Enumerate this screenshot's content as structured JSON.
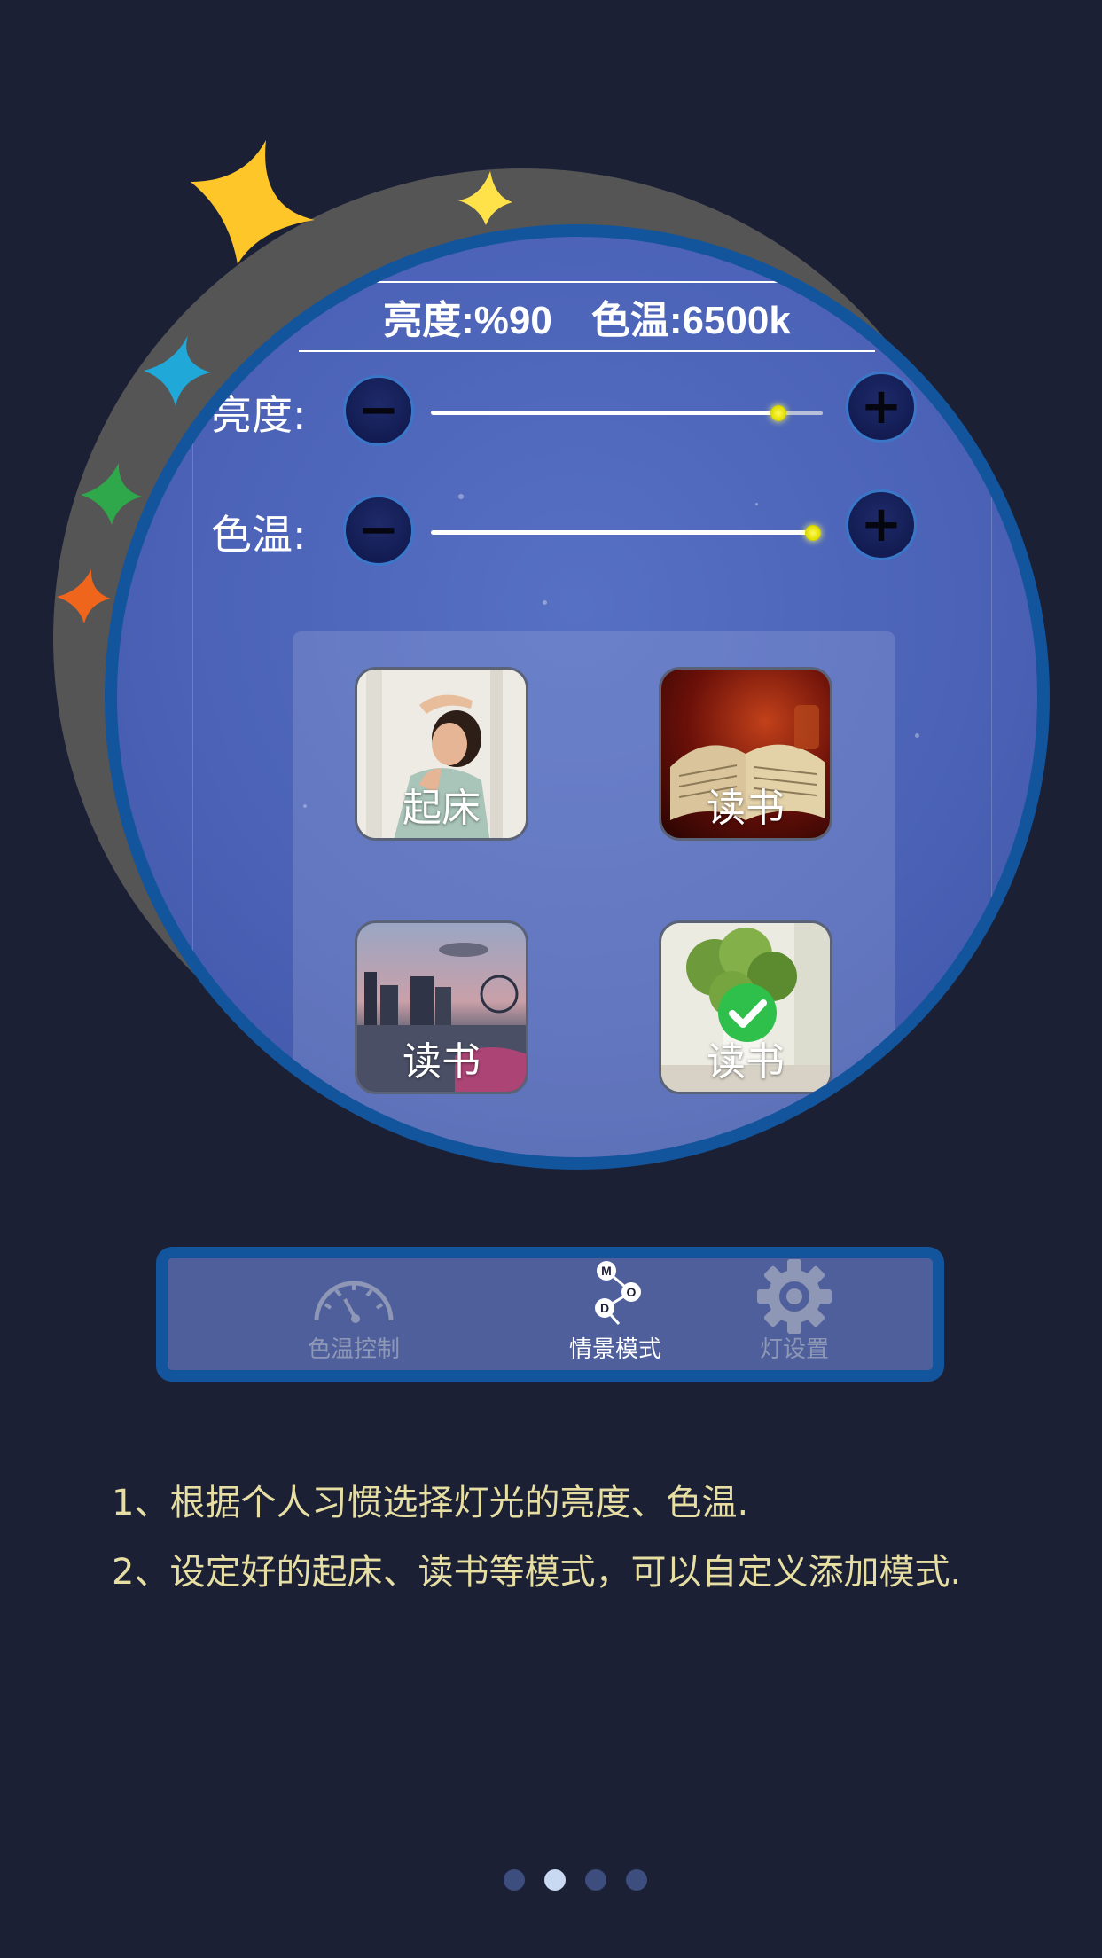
{
  "status": {
    "brightness_text": "亮度:%90",
    "color_temp_text": "色温:6500k"
  },
  "controls": {
    "brightness_label": "亮度:",
    "color_temp_label": "色温:",
    "minus_symbol": "−",
    "plus_symbol": "+",
    "brightness_value": 0.88,
    "color_temp_value": 0.97
  },
  "scenes": [
    {
      "label": "起床",
      "image": "woman-waking-up",
      "selected": false
    },
    {
      "label": "读书",
      "image": "open-book",
      "selected": false
    },
    {
      "label": "读书",
      "image": "city-at-dusk",
      "selected": false
    },
    {
      "label": "读书",
      "image": "potted-plant",
      "selected": true
    }
  ],
  "nav": [
    {
      "label": "色温控制",
      "icon": "gauge-icon",
      "active": false
    },
    {
      "label": "情景模式",
      "icon": "mode-nodes-icon",
      "active": true,
      "icon_letters": [
        "M",
        "O",
        "D"
      ]
    },
    {
      "label": "灯设置",
      "icon": "gear-icon",
      "active": false
    }
  ],
  "description": [
    "1、根据个人习惯选择灯光的亮度、色温.",
    "2、设定好的起床、读书等模式，可以自定义添加模式."
  ],
  "pagination": {
    "total": 4,
    "current": 2
  },
  "colors": {
    "background": "#1b2035",
    "circle_blue": "#4b62b6",
    "ring": "#12559c",
    "description_text": "#e6dea2",
    "nav_active": "#ffffff",
    "nav_inactive": "#8e97b5"
  }
}
